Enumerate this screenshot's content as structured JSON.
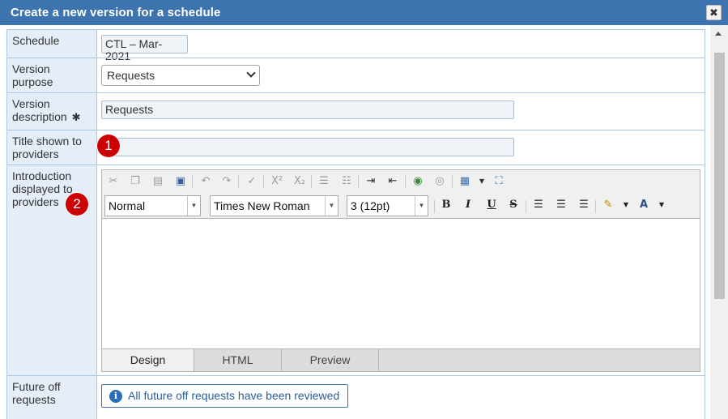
{
  "window": {
    "title": "Create a new version for a schedule",
    "close_symbol": "✖"
  },
  "form": {
    "schedule": {
      "label": "Schedule",
      "value": "CTL – Mar-2021"
    },
    "version_purpose": {
      "label": "Version purpose",
      "selected": "Requests"
    },
    "version_description": {
      "label": "Version description",
      "required_mark": "✱",
      "value": "Requests"
    },
    "title_shown": {
      "label": "Title shown to providers",
      "value": "",
      "badge": "1"
    },
    "introduction": {
      "label": "Introduction displayed to providers",
      "badge": "2",
      "editor": {
        "format": "Normal",
        "font": "Times New Roman",
        "size": "3 (12pt)",
        "tabs": [
          "Design",
          "HTML",
          "Preview"
        ],
        "active_tab": "Design",
        "toolbar_icons": [
          "cut-icon",
          "copy-icon",
          "paste-icon",
          "paste-word-icon",
          "undo-icon",
          "redo-icon",
          "spellcheck-icon",
          "superscript-icon",
          "subscript-icon",
          "ordered-list-icon",
          "unordered-list-icon",
          "indent-icon",
          "outdent-icon",
          "insert-link-icon",
          "remove-link-icon",
          "insert-table-icon",
          "fullscreen-icon",
          "bold-icon",
          "italic-icon",
          "underline-icon",
          "strikethrough-icon",
          "align-left-icon",
          "align-center-icon",
          "align-right-icon",
          "highlight-icon",
          "font-color-icon"
        ]
      }
    },
    "future_off": {
      "label": "Future off requests",
      "button": "All future off requests have been reviewed",
      "info_symbol": "i"
    }
  },
  "colors": {
    "titlebar": "#3d74b0",
    "label_bg": "#e4edf8",
    "border": "#a9c6e4",
    "badge": "#cc0000"
  }
}
